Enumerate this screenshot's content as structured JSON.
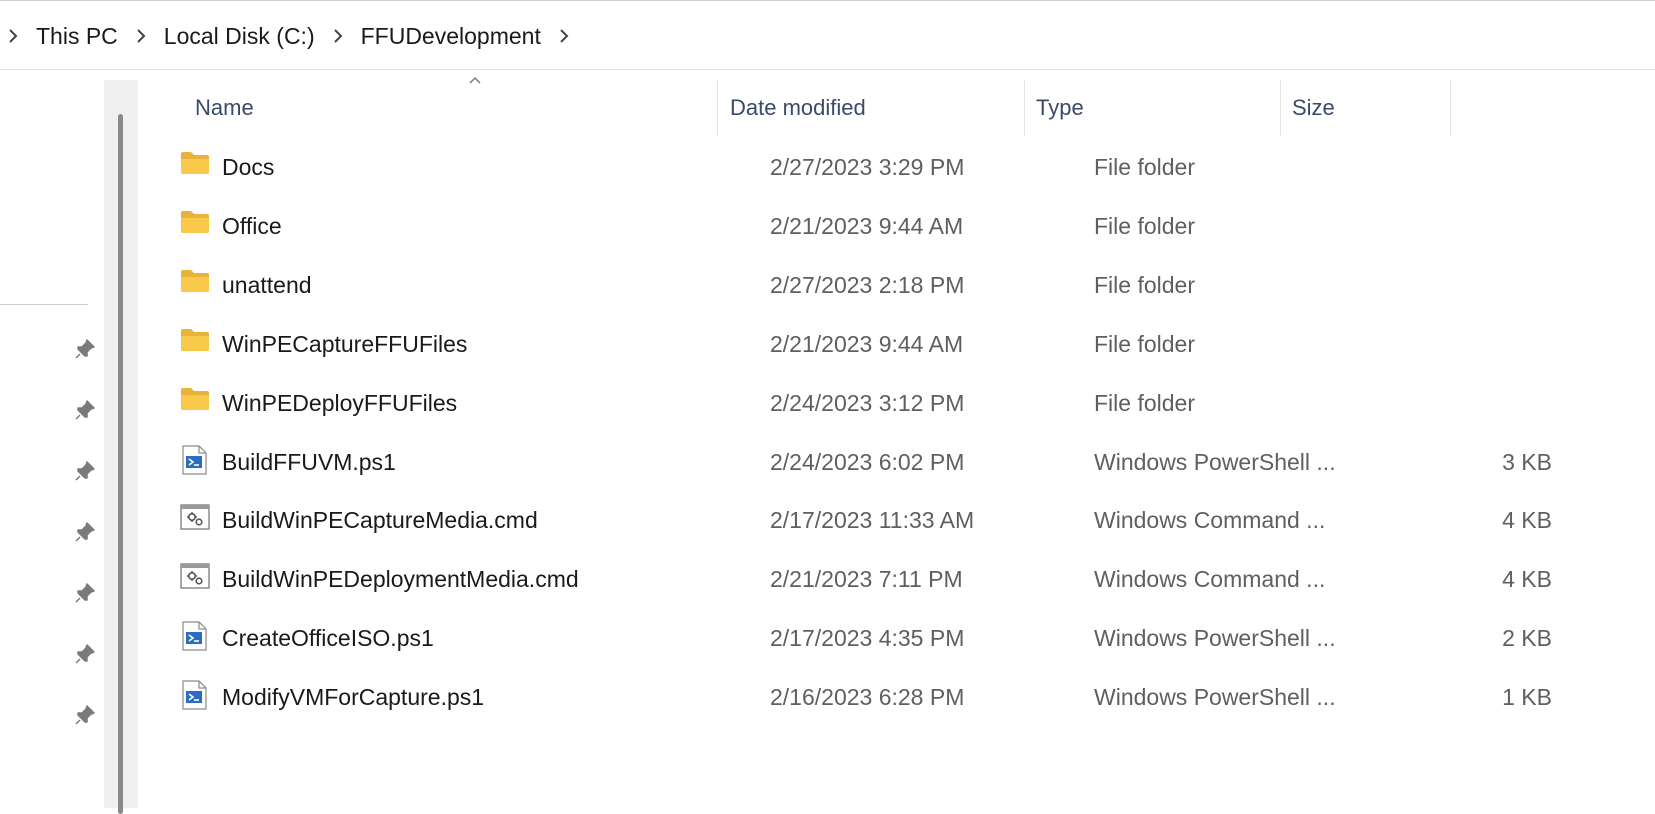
{
  "breadcrumb": {
    "items": [
      "This PC",
      "Local Disk (C:)",
      "FFUDevelopment"
    ]
  },
  "columns": {
    "name": "Name",
    "date": "Date modified",
    "type": "Type",
    "size": "Size"
  },
  "files": [
    {
      "name": "Docs",
      "date": "2/27/2023 3:29 PM",
      "type": "File folder",
      "size": "",
      "icon": "folder-icon"
    },
    {
      "name": "Office",
      "date": "2/21/2023 9:44 AM",
      "type": "File folder",
      "size": "",
      "icon": "folder-icon"
    },
    {
      "name": "unattend",
      "date": "2/27/2023 2:18 PM",
      "type": "File folder",
      "size": "",
      "icon": "folder-icon"
    },
    {
      "name": "WinPECaptureFFUFiles",
      "date": "2/21/2023 9:44 AM",
      "type": "File folder",
      "size": "",
      "icon": "folder-icon"
    },
    {
      "name": "WinPEDeployFFUFiles",
      "date": "2/24/2023 3:12 PM",
      "type": "File folder",
      "size": "",
      "icon": "folder-icon"
    },
    {
      "name": "BuildFFUVM.ps1",
      "date": "2/24/2023 6:02 PM",
      "type": "Windows PowerShell ...",
      "size": "3 KB",
      "icon": "powershell-file-icon"
    },
    {
      "name": "BuildWinPECaptureMedia.cmd",
      "date": "2/17/2023 11:33 AM",
      "type": "Windows Command ...",
      "size": "4 KB",
      "icon": "cmd-file-icon"
    },
    {
      "name": "BuildWinPEDeploymentMedia.cmd",
      "date": "2/21/2023 7:11 PM",
      "type": "Windows Command ...",
      "size": "4 KB",
      "icon": "cmd-file-icon"
    },
    {
      "name": "CreateOfficeISO.ps1",
      "date": "2/17/2023 4:35 PM",
      "type": "Windows PowerShell ...",
      "size": "2 KB",
      "icon": "powershell-file-icon"
    },
    {
      "name": "ModifyVMForCapture.ps1",
      "date": "2/16/2023 6:28 PM",
      "type": "Windows PowerShell ...",
      "size": "1 KB",
      "icon": "powershell-file-icon"
    }
  ],
  "colors": {
    "folder": "#f8c94a",
    "folder_dark": "#e9b23a",
    "header_text": "#3a4a6a",
    "secondary_text": "#5f5f5f",
    "ps_blue": "#2b6cc4"
  }
}
